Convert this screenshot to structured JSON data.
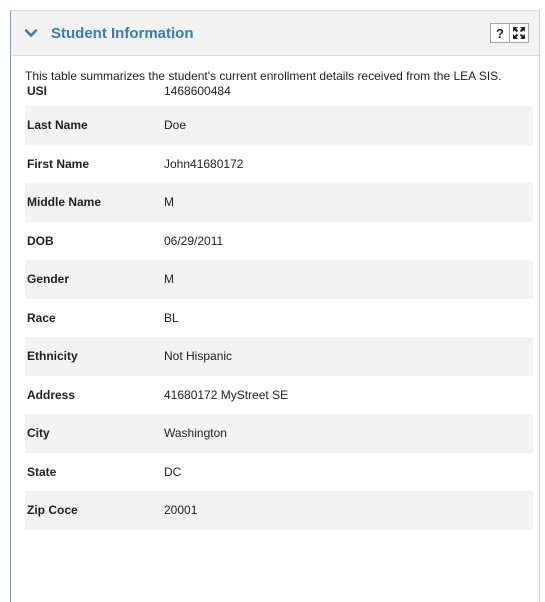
{
  "panel": {
    "title": "Student Information",
    "help_label": "?",
    "description": "This table summarizes the student's current enrollment details received from the LEA SIS."
  },
  "fields": [
    {
      "label": "USI",
      "value": "1468600484"
    },
    {
      "label": "Last Name",
      "value": "Doe"
    },
    {
      "label": "First Name",
      "value": "John41680172"
    },
    {
      "label": "Middle Name",
      "value": "M"
    },
    {
      "label": "DOB",
      "value": "06/29/2011"
    },
    {
      "label": "Gender",
      "value": "M"
    },
    {
      "label": "Race",
      "value": "BL"
    },
    {
      "label": "Ethnicity",
      "value": "Not Hispanic"
    },
    {
      "label": "Address",
      "value": "41680172 MyStreet SE"
    },
    {
      "label": "City",
      "value": "Washington"
    },
    {
      "label": "State",
      "value": "DC"
    },
    {
      "label": "Zip Coce",
      "value": "20001"
    }
  ],
  "icons": {
    "collapse": "chevron-down-icon",
    "help": "question-icon",
    "expand": "expand-icon"
  },
  "colors": {
    "title": "#3a7ab8",
    "header_bg": "#f3f3f3",
    "stripe": "#f3f3f3"
  }
}
